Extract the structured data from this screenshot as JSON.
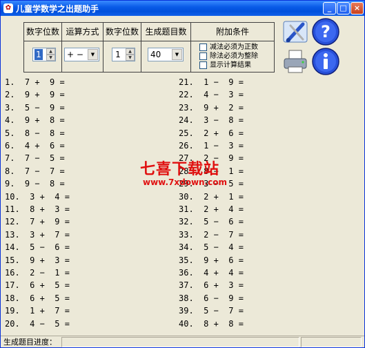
{
  "window": {
    "title": "儿童学数学之出题助手"
  },
  "titlebar_buttons": {
    "minimize": "_",
    "maximize": "□",
    "close": "×"
  },
  "panel": {
    "headers": [
      "数字位数",
      "运算方式",
      "数字位数",
      "生成题目数",
      "附加条件"
    ],
    "digits1": "1",
    "operation": "+ −",
    "digits2": "1",
    "count": "40",
    "options": [
      "减法必须为正数",
      "除法必须为整除",
      "显示计算结果"
    ]
  },
  "icons": {
    "tools": "paint-tools-icon",
    "help": "help-icon",
    "print": "printer-icon",
    "info": "info-icon"
  },
  "problems_left": [
    "1.  7 +  9 =",
    "2.  9 +  9 =",
    "3.  5 −  9 =",
    "4.  9 +  8 =",
    "5.  8 −  8 =",
    "6.  4 +  6 =",
    "7.  7 −  5 =",
    "8.  7 −  7 =",
    "9.  9 −  8 =",
    "10.  3 +  4 =",
    "11.  8 +  3 =",
    "12.  7 +  9 =",
    "13.  3 +  7 =",
    "14.  5 −  6 =",
    "15.  9 +  3 =",
    "16.  2 −  1 =",
    "17.  6 +  5 =",
    "18.  6 +  5 =",
    "19.  1 +  7 =",
    "20.  4 −  5 ="
  ],
  "problems_right": [
    "21.  1 −  9 =",
    "22.  4 −  3 =",
    "23.  9 +  2 =",
    "24.  3 −  8 =",
    "25.  2 +  6 =",
    "26.  1 −  3 =",
    "27.  2 −  9 =",
    "28.  8 −  1 =",
    "29.  3 −  5 =",
    "30.  2 +  1 =",
    "31.  2 +  4 =",
    "32.  5 −  6 =",
    "33.  2 −  7 =",
    "34.  5 −  4 =",
    "35.  9 +  6 =",
    "36.  4 +  4 =",
    "37.  6 +  3 =",
    "38.  6 −  9 =",
    "39.  5 −  7 =",
    "40.  8 +  8 ="
  ],
  "watermark": {
    "text": "七喜下载站",
    "url": "www.7xdown.com"
  },
  "status": {
    "label": "生成题目进度："
  },
  "colors": {
    "titlebar": "#0a5ce8",
    "window_bg": "#ece9d8",
    "watermark": "#e01010"
  }
}
